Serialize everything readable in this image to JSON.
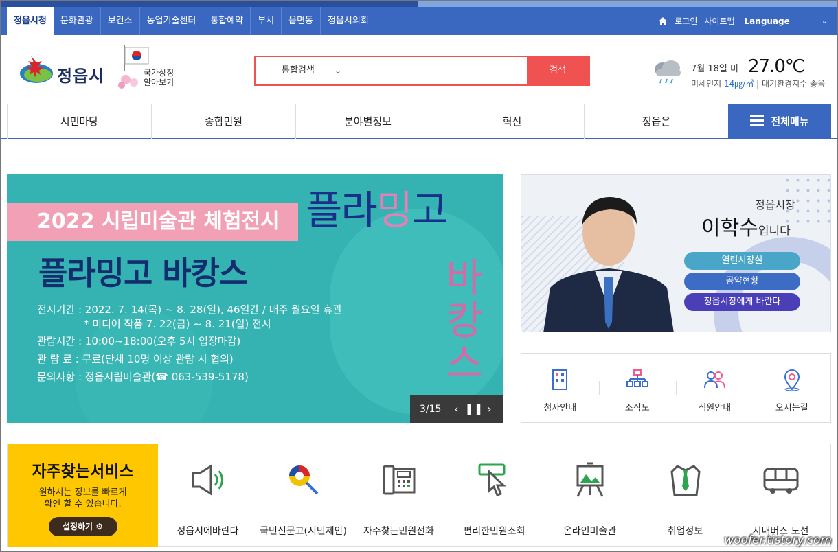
{
  "top_tabs": [
    "정읍시청",
    "문화관광",
    "보건소",
    "농업기술센터",
    "통합예약",
    "부서",
    "읍면동",
    "정읍시의회"
  ],
  "top_links": {
    "login": "로그인",
    "sitemap": "사이트맵",
    "language": "Language"
  },
  "logo": {
    "name": "정읍시"
  },
  "symbols": {
    "line1": "국가상징",
    "line2": "알아보기"
  },
  "search": {
    "select_value": "통합검색",
    "button": "검색",
    "placeholder": ""
  },
  "weather": {
    "date": "7월 18일 비",
    "temp": "27.0℃",
    "dust_label": "미세먼지",
    "dust_value": "14㎍/㎥",
    "air_index": " | 대기환경지수 좋음"
  },
  "main_nav": [
    "시민마당",
    "종합민원",
    "분야별정보",
    "혁신",
    "정읍은"
  ],
  "all_menu": "전체메뉴",
  "banner": {
    "tag": "2022 시립미술관 체험전시",
    "title": "플라밍고 바캉스",
    "lines": [
      "전시기간 : 2022. 7. 14(목) ~ 8. 28(일), 46일간 / 매주 월요일 휴관",
      "* 미디어 작품 7. 22(금) ~ 8. 21(일) 전시",
      "관람시간 : 10:00~18:00(오후 5시 입장마감)",
      "관 람 료 : 무료(단체 10명 이상 관람 시 협의)",
      "문의사항 : 정읍시립미술관(☎ 063-539-5178)"
    ],
    "vertical_title_a": "플라",
    "vertical_title_b": "밍",
    "vertical_title_c": "고",
    "vertical_stack": [
      "바",
      "캉",
      "스"
    ],
    "counter": "3/15"
  },
  "mayor": {
    "role": "정읍시장",
    "name": "이학수",
    "suffix": "입니다",
    "buttons": [
      {
        "label": "열린시장실",
        "color": "#4aa6c8"
      },
      {
        "label": "공약현황",
        "color": "#3d6cc4"
      },
      {
        "label": "정읍시장에게 바란다",
        "color": "#4b3fb8"
      }
    ]
  },
  "quick_links": [
    {
      "label": "청사안내",
      "icon": "building-icon"
    },
    {
      "label": "조직도",
      "icon": "org-chart-icon"
    },
    {
      "label": "직원안내",
      "icon": "people-icon"
    },
    {
      "label": "오시는길",
      "icon": "location-pin-icon"
    }
  ],
  "services": {
    "title": "자주찾는서비스",
    "desc_line1": "원하시는 정보를 빠르게",
    "desc_line2": "확인 할 수 있습니다.",
    "setup": "설정하기",
    "items": [
      {
        "label": "정읍시에바란다",
        "icon": "megaphone-icon"
      },
      {
        "label": "국민신문고(시민제안)",
        "icon": "petition-drum-icon"
      },
      {
        "label": "자주찾는민원전화",
        "icon": "phone-icon"
      },
      {
        "label": "편리한민원조회",
        "icon": "click-cursor-icon"
      },
      {
        "label": "온라인미술관",
        "icon": "easel-icon"
      },
      {
        "label": "취업정보",
        "icon": "shirt-tie-icon"
      },
      {
        "label": "시내버스 노선",
        "icon": "bus-icon"
      }
    ]
  },
  "watermark": "woofer.tistory.com"
}
